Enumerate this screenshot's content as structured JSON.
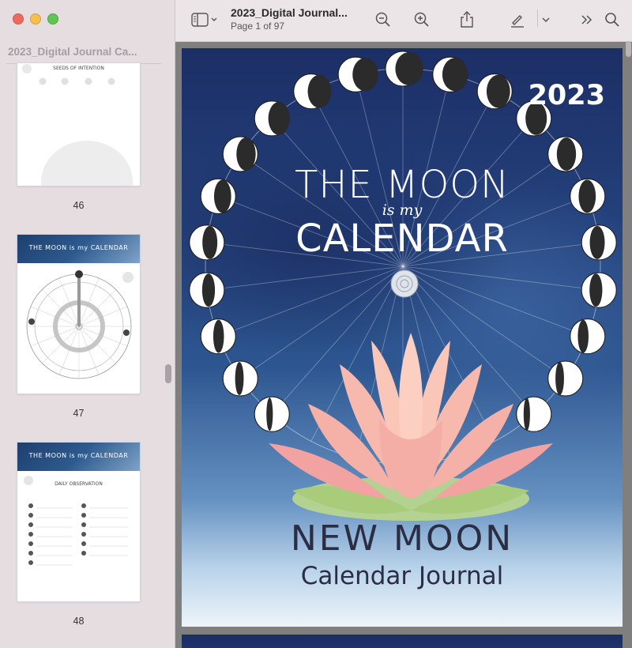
{
  "window": {
    "doc_title": "2023_Digital Journal...",
    "page_info": "Page 1 of 97"
  },
  "sidebar": {
    "title": "2023_Digital Journal Ca...",
    "thumbnails": [
      {
        "number": "46",
        "heading": "SEEDS OF INTENTION"
      },
      {
        "number": "47",
        "banner": "THE MOON is my CALENDAR"
      },
      {
        "number": "48",
        "banner": "THE MOON is my CALENDAR",
        "heading": "DAILY OBSERVATION"
      }
    ]
  },
  "cover": {
    "year": "2023",
    "title_line1": "THE MOON",
    "title_line2": "is my",
    "title_line3": "CALENDAR",
    "subtitle_line1": "NEW MOON",
    "subtitle_line2": "Calendar Journal"
  },
  "icons": {
    "sidebar_toggle": "sidebar-icon",
    "zoom_out": "zoom-out-icon",
    "zoom_in": "zoom-in-icon",
    "share": "share-icon",
    "markup": "pen-icon",
    "more": "chevrons-right-icon",
    "search": "search-icon"
  }
}
